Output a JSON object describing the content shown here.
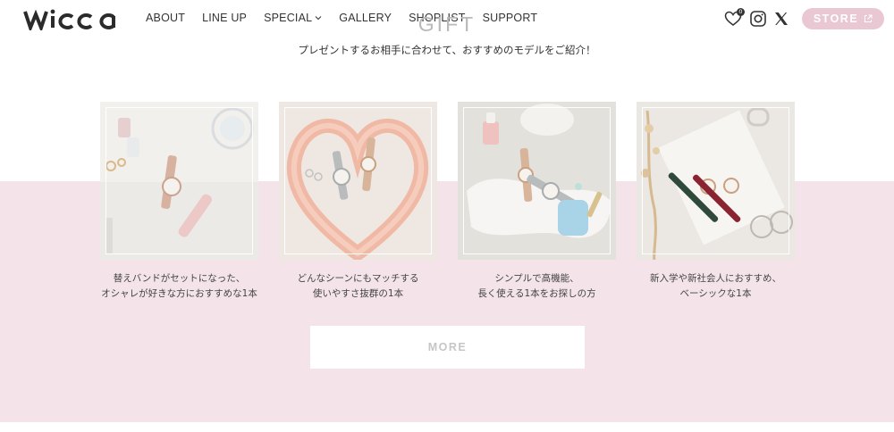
{
  "brand": {
    "logo_text": "wicca"
  },
  "nav": {
    "items": [
      {
        "label": "ABOUT"
      },
      {
        "label": "LINE UP"
      },
      {
        "label": "SPECIAL"
      },
      {
        "label": "GALLERY"
      },
      {
        "label": "SHOPLIST"
      },
      {
        "label": "SUPPORT"
      }
    ]
  },
  "header_icons": {
    "favorites_count": "0",
    "icons": [
      "heart-icon",
      "instagram-icon",
      "x-icon",
      "external-link-icon"
    ]
  },
  "store": {
    "label": "STORE"
  },
  "section": {
    "title": "GIFT",
    "subtitle": "プレゼントするお相手に合わせて、おすすめのモデルをご紹介！"
  },
  "cards": [
    {
      "line1": "替えバンドがセットになった、",
      "line2": "オシャレが好きな方におすすめな1本"
    },
    {
      "line1": "どんなシーンにもマッチする",
      "line2": "使いやすさ抜群の1本"
    },
    {
      "line1": "シンプルで高機能、",
      "line2": "長く使える1本をお探しの方"
    },
    {
      "line1": "新入学や新社会人におすすめ、",
      "line2": "ベーシックな1本"
    }
  ],
  "more": {
    "label": "MORE"
  },
  "colors": {
    "pink_band": "#f4e4ea",
    "store_button": "#e9c8d4",
    "text": "#333333"
  }
}
